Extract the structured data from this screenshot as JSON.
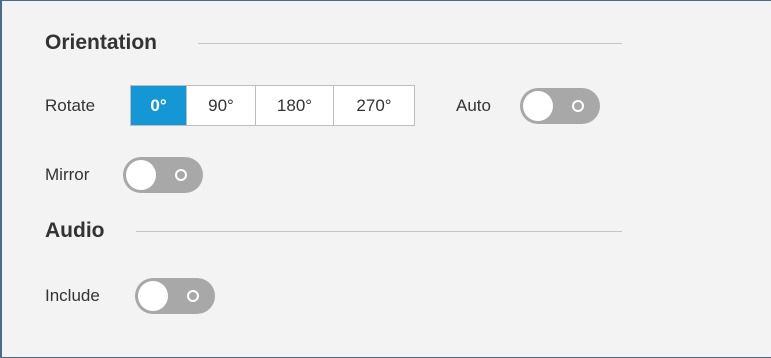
{
  "orientation": {
    "title": "Orientation",
    "rotate_label": "Rotate",
    "rotate_options": [
      "0°",
      "90°",
      "180°",
      "270°"
    ],
    "rotate_selected": "0°",
    "auto_label": "Auto",
    "auto_on": false,
    "mirror_label": "Mirror",
    "mirror_on": false
  },
  "audio": {
    "title": "Audio",
    "include_label": "Include",
    "include_on": false
  },
  "colors": {
    "accent": "#1597d6",
    "toggle_off": "#a8a8a8",
    "frame_border": "#4a6b8a"
  }
}
